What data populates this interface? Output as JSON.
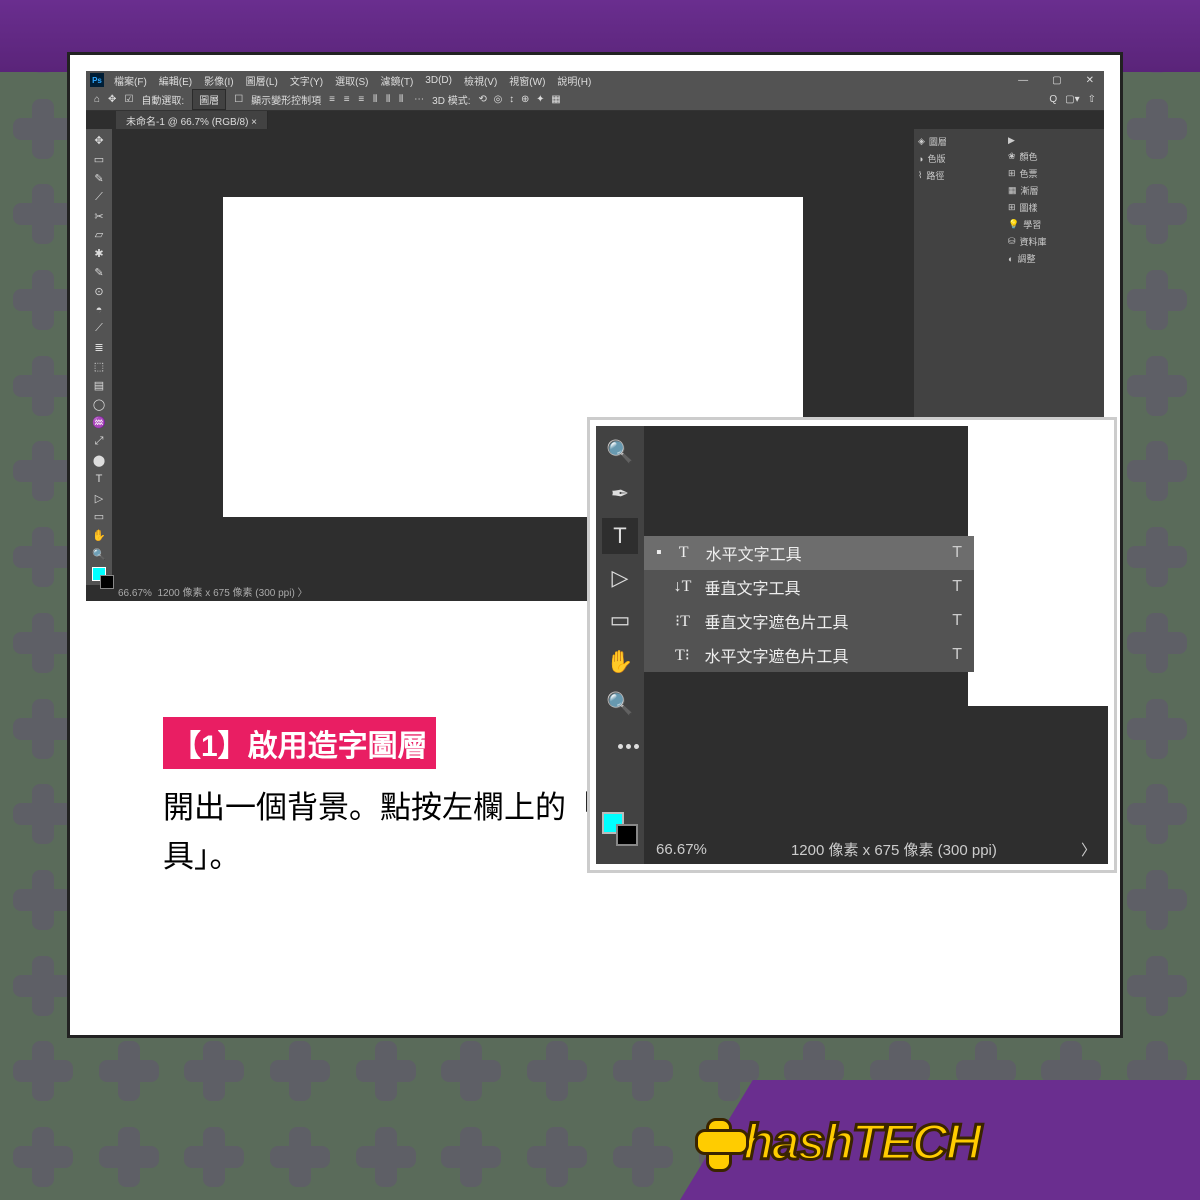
{
  "menu": {
    "items": [
      "檔案(F)",
      "編輯(E)",
      "影像(I)",
      "圖層(L)",
      "文字(Y)",
      "選取(S)",
      "濾鏡(T)",
      "3D(D)",
      "檢視(V)",
      "視窗(W)",
      "說明(H)"
    ]
  },
  "optbar": {
    "auto_select": "自動選取:",
    "layer": "圖層",
    "transform": "顯示變形控制項",
    "mode": "3D 模式:"
  },
  "tab": {
    "title": "未命名-1 @ 66.7% (RGB/8)"
  },
  "tools": [
    "✥",
    "▭",
    "✎",
    "⟋",
    "✂",
    "▱",
    "✱",
    "✎",
    "⊙",
    "◓",
    "⟋",
    "≣",
    "⬚",
    "▤",
    "◯",
    "♒",
    "⤢",
    "⬤",
    "T",
    "▷",
    "▭",
    "✋",
    "🔍",
    "⋯"
  ],
  "right_panels": [
    {
      "icon": "◈",
      "label": "圖層"
    },
    {
      "icon": "◑",
      "label": "色版"
    },
    {
      "icon": "⌇",
      "label": "路徑"
    }
  ],
  "right_panels2": [
    {
      "icon": "▶",
      "label": ""
    },
    {
      "icon": "❀",
      "label": "顏色"
    },
    {
      "icon": "⊞",
      "label": "色票"
    },
    {
      "icon": "▦",
      "label": "漸層"
    },
    {
      "icon": "⊞",
      "label": "圖樣"
    },
    {
      "icon": "💡",
      "label": "學習"
    },
    {
      "icon": "⛁",
      "label": "資料庫"
    },
    {
      "icon": "◐",
      "label": "調整"
    }
  ],
  "status": {
    "zoom": "66.67%",
    "dims": "1200 像素 x 675 像素 (300 ppi)"
  },
  "inset": {
    "tools": [
      "🔍",
      "✒",
      "T",
      "▷",
      "▭",
      "✋",
      "🔍",
      "⋯"
    ],
    "active_index": 2,
    "flyout": [
      {
        "icon": "T",
        "label": "水平文字工具",
        "key": "T",
        "sel": true
      },
      {
        "icon": "↓T",
        "label": "垂直文字工具",
        "key": "T"
      },
      {
        "icon": "⁝T",
        "label": "垂直文字遮色片工具",
        "key": "T"
      },
      {
        "icon": "T⁝",
        "label": "水平文字遮色片工具",
        "key": "T"
      }
    ],
    "status": {
      "zoom": "66.67%",
      "dims": "1200 像素 x 675 像素 (300 ppi)",
      "arrow": "〉"
    }
  },
  "caption": {
    "title": "【1】啟用造字圖層",
    "body": "開出一個背景。點按左欄上的「T」圖示打開「水平文字工具」。"
  },
  "brand": "hashTECH"
}
